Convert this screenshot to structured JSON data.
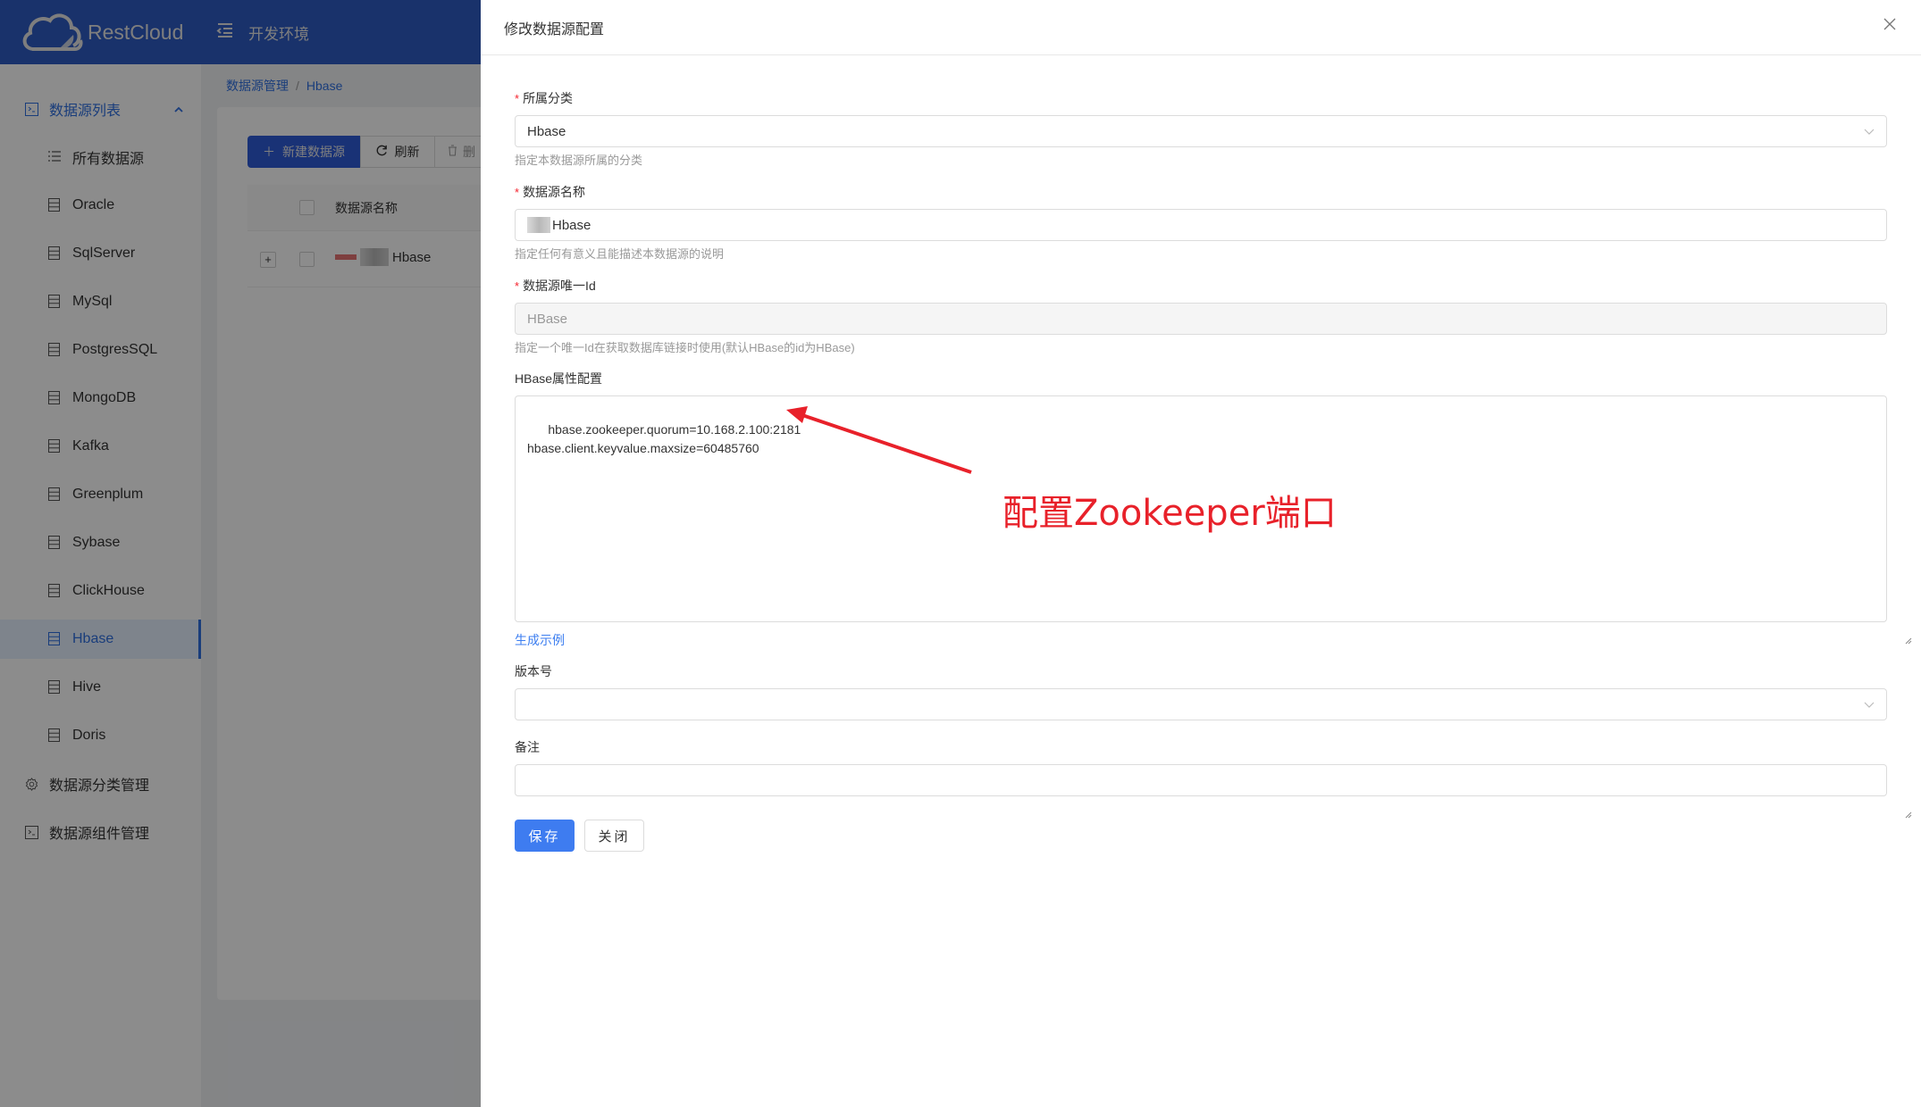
{
  "app": {
    "brand": "RestCloud",
    "environment": "开发环境"
  },
  "sidebar": {
    "groups": [
      {
        "label": "数据源列表",
        "icon": "terminal-box-icon",
        "expanded": true
      },
      {
        "label": "数据源分类管理",
        "icon": "gear-icon"
      },
      {
        "label": "数据源组件管理",
        "icon": "terminal-box-icon"
      }
    ],
    "items": [
      {
        "label": "所有数据源",
        "icon": "list-icon"
      },
      {
        "label": "Oracle",
        "icon": "database-icon"
      },
      {
        "label": "SqlServer",
        "icon": "database-icon"
      },
      {
        "label": "MySql",
        "icon": "database-icon"
      },
      {
        "label": "PostgresSQL",
        "icon": "database-icon"
      },
      {
        "label": "MongoDB",
        "icon": "database-icon"
      },
      {
        "label": "Kafka",
        "icon": "database-icon"
      },
      {
        "label": "Greenplum",
        "icon": "database-icon"
      },
      {
        "label": "Sybase",
        "icon": "database-icon"
      },
      {
        "label": "ClickHouse",
        "icon": "database-icon"
      },
      {
        "label": "Hbase",
        "icon": "database-icon",
        "active": true
      },
      {
        "label": "Hive",
        "icon": "database-icon"
      },
      {
        "label": "Doris",
        "icon": "database-icon"
      }
    ]
  },
  "breadcrumb": [
    "数据源管理",
    "Hbase"
  ],
  "toolbar": {
    "new_label": "新建数据源",
    "refresh_label": "刷新",
    "delete_label": "删"
  },
  "table": {
    "columns": [
      "数据源名称"
    ],
    "rows": [
      {
        "name": "Hbase"
      }
    ]
  },
  "drawer": {
    "title": "修改数据源配置",
    "fields": {
      "category": {
        "label": "所属分类",
        "required": true,
        "value": "Hbase",
        "help": "指定本数据源所属的分类"
      },
      "name": {
        "label": "数据源名称",
        "required": true,
        "value": "Hbase",
        "help": "指定任何有意义且能描述本数据源的说明"
      },
      "unique_id": {
        "label": "数据源唯一Id",
        "required": true,
        "value": "HBase",
        "help": "指定一个唯一Id在获取数据库链接时使用(默认HBase的id为HBase)"
      },
      "properties": {
        "label": "HBase属性配置",
        "value": "hbase.zookeeper.quorum=10.168.2.100:2181\nhbase.client.keyvalue.maxsize=60485760",
        "generate_link": "生成示例"
      },
      "version": {
        "label": "版本号",
        "value": ""
      },
      "remark": {
        "label": "备注",
        "value": ""
      }
    },
    "buttons": {
      "save": "保存",
      "close": "关闭"
    }
  },
  "annotation": {
    "text": "配置Zookeeper端口",
    "color": "#e8212a"
  }
}
